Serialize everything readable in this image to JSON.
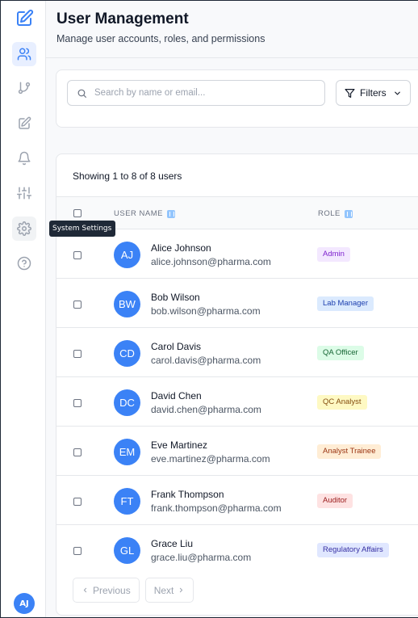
{
  "sidebar": {
    "tooltip": "System Settings",
    "avatar_initials": "AJ"
  },
  "header": {
    "title": "User Management",
    "subtitle": "Manage user accounts, roles, and permissions"
  },
  "search": {
    "placeholder": "Search by name or email...",
    "value": ""
  },
  "filters": {
    "label": "Filters"
  },
  "table": {
    "showing": "Showing 1 to 8 of 8 users",
    "columns": {
      "user_name": "USER NAME",
      "role": "ROLE"
    },
    "rows": [
      {
        "initials": "AJ",
        "name": "Alice Johnson",
        "email": "alice.johnson@pharma.com",
        "role": "Admin",
        "role_bg": "#f3e8ff",
        "role_fg": "#7e22ce"
      },
      {
        "initials": "BW",
        "name": "Bob Wilson",
        "email": "bob.wilson@pharma.com",
        "role": "Lab Manager",
        "role_bg": "#dbeafe",
        "role_fg": "#1e40af"
      },
      {
        "initials": "CD",
        "name": "Carol Davis",
        "email": "carol.davis@pharma.com",
        "role": "QA Officer",
        "role_bg": "#dcfce7",
        "role_fg": "#166534"
      },
      {
        "initials": "DC",
        "name": "David Chen",
        "email": "david.chen@pharma.com",
        "role": "QC Analyst",
        "role_bg": "#fef9c3",
        "role_fg": "#854d0e"
      },
      {
        "initials": "EM",
        "name": "Eve Martinez",
        "email": "eve.martinez@pharma.com",
        "role": "Analyst Trainee",
        "role_bg": "#ffedd5",
        "role_fg": "#9a3412"
      },
      {
        "initials": "FT",
        "name": "Frank Thompson",
        "email": "frank.thompson@pharma.com",
        "role": "Auditor",
        "role_bg": "#fee2e2",
        "role_fg": "#991b1b"
      },
      {
        "initials": "GL",
        "name": "Grace Liu",
        "email": "grace.liu@pharma.com",
        "role": "Regulatory Affairs",
        "role_bg": "#e0e7ff",
        "role_fg": "#3730a3"
      }
    ]
  },
  "pagination": {
    "previous": "Previous",
    "next": "Next"
  },
  "colors": {
    "accent": "#3b82f6",
    "active_nav_bg": "#e8efff"
  }
}
